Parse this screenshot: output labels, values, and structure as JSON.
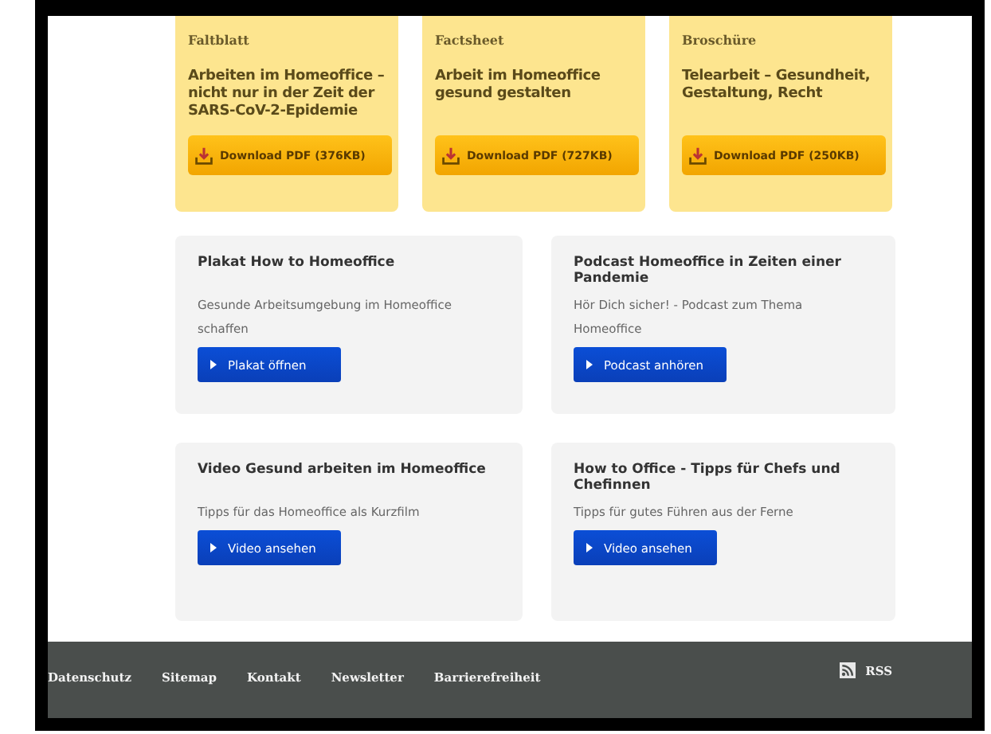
{
  "downloads": [
    {
      "type_label": "Faltblatt",
      "title": "Arbeiten im Homeoffice – nicht nur in der Zeit der SARS-CoV-2-Epidemie",
      "button": "Download PDF (376KB)"
    },
    {
      "type_label": "Factsheet",
      "title": "Arbeit im Homeoffice gesund gestalten",
      "button": "Download PDF (727KB)"
    },
    {
      "type_label": "Broschüre",
      "title": "Telearbeit – Gesundheit, Gestaltung, Recht",
      "button": "Download PDF (250KB)"
    }
  ],
  "teasers": [
    {
      "title": "Plakat How to Homeoffice",
      "text": "Gesunde Arbeitsumgebung im Homeoffice schaffen",
      "button": "Plakat öffnen"
    },
    {
      "title": "Podcast Homeoffice in Zeiten einer Pandemie",
      "text": "Hör Dich sicher! - Podcast zum Thema Homeoffice",
      "button": "Podcast anhören"
    },
    {
      "title": "Video Gesund arbeiten im Homeoffice",
      "text": "Tipps für das Homeoffice als Kurzfilm",
      "button": "Video ansehen"
    },
    {
      "title": "How to Office - Tipps für Chefs und Chefinnen",
      "text": "Tipps für gutes Führen aus der Ferne",
      "button": "Video ansehen"
    }
  ],
  "footer": {
    "links": [
      "Datenschutz",
      "Sitemap",
      "Kontakt",
      "Newsletter",
      "Barrierefreiheit"
    ],
    "rss": "RSS"
  }
}
